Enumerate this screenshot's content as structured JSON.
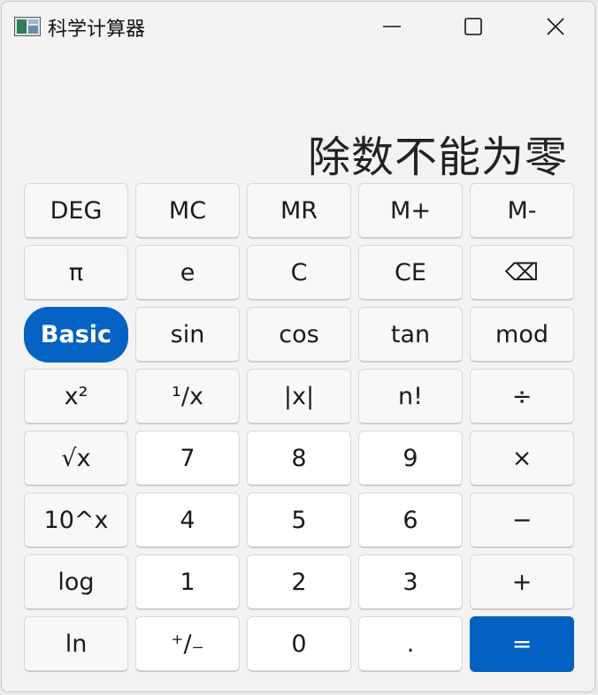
{
  "window": {
    "title": "科学计算器",
    "icon": "calculator-app-icon"
  },
  "controls": {
    "minimize": "minimize-icon",
    "maximize": "maximize-icon",
    "close": "close-icon"
  },
  "display": {
    "text": "除数不能为零"
  },
  "colors": {
    "accent": "#0463c3",
    "background": "#f3f3f3"
  },
  "keys": [
    {
      "label": "DEG",
      "name": "deg-button",
      "style": "fn"
    },
    {
      "label": "MC",
      "name": "mc-button",
      "style": "fn"
    },
    {
      "label": "MR",
      "name": "mr-button",
      "style": "fn"
    },
    {
      "label": "M+",
      "name": "m-plus-button",
      "style": "fn"
    },
    {
      "label": "M-",
      "name": "m-minus-button",
      "style": "fn"
    },
    {
      "label": "π",
      "name": "pi-button",
      "style": "fn"
    },
    {
      "label": "e",
      "name": "e-button",
      "style": "fn"
    },
    {
      "label": "C",
      "name": "clear-button",
      "style": "fn"
    },
    {
      "label": "CE",
      "name": "clear-entry-button",
      "style": "fn"
    },
    {
      "label": "⌫",
      "name": "backspace-button",
      "style": "fn"
    },
    {
      "label": "Basic",
      "name": "basic-mode-button",
      "style": "basic"
    },
    {
      "label": "sin",
      "name": "sin-button",
      "style": "fn"
    },
    {
      "label": "cos",
      "name": "cos-button",
      "style": "fn"
    },
    {
      "label": "tan",
      "name": "tan-button",
      "style": "fn"
    },
    {
      "label": "mod",
      "name": "mod-button",
      "style": "fn"
    },
    {
      "label": "x²",
      "name": "square-button",
      "style": "fn"
    },
    {
      "label": "¹/x",
      "name": "reciprocal-button",
      "style": "fn"
    },
    {
      "label": "|x|",
      "name": "abs-button",
      "style": "fn"
    },
    {
      "label": "n!",
      "name": "factorial-button",
      "style": "fn"
    },
    {
      "label": "÷",
      "name": "divide-button",
      "style": "fn"
    },
    {
      "label": "√x",
      "name": "sqrt-button",
      "style": "fn"
    },
    {
      "label": "7",
      "name": "digit-7-button",
      "style": "num"
    },
    {
      "label": "8",
      "name": "digit-8-button",
      "style": "num"
    },
    {
      "label": "9",
      "name": "digit-9-button",
      "style": "num"
    },
    {
      "label": "×",
      "name": "multiply-button",
      "style": "fn"
    },
    {
      "label": "10^x",
      "name": "pow10-button",
      "style": "fn"
    },
    {
      "label": "4",
      "name": "digit-4-button",
      "style": "num"
    },
    {
      "label": "5",
      "name": "digit-5-button",
      "style": "num"
    },
    {
      "label": "6",
      "name": "digit-6-button",
      "style": "num"
    },
    {
      "label": "−",
      "name": "subtract-button",
      "style": "fn"
    },
    {
      "label": "log",
      "name": "log-button",
      "style": "fn"
    },
    {
      "label": "1",
      "name": "digit-1-button",
      "style": "num"
    },
    {
      "label": "2",
      "name": "digit-2-button",
      "style": "num"
    },
    {
      "label": "3",
      "name": "digit-3-button",
      "style": "num"
    },
    {
      "label": "+",
      "name": "add-button",
      "style": "fn"
    },
    {
      "label": "ln",
      "name": "ln-button",
      "style": "fn"
    },
    {
      "label": "⁺/₋",
      "name": "negate-button",
      "style": "num"
    },
    {
      "label": "0",
      "name": "digit-0-button",
      "style": "num"
    },
    {
      "label": ".",
      "name": "decimal-button",
      "style": "num"
    },
    {
      "label": "=",
      "name": "equals-button",
      "style": "equals"
    }
  ]
}
